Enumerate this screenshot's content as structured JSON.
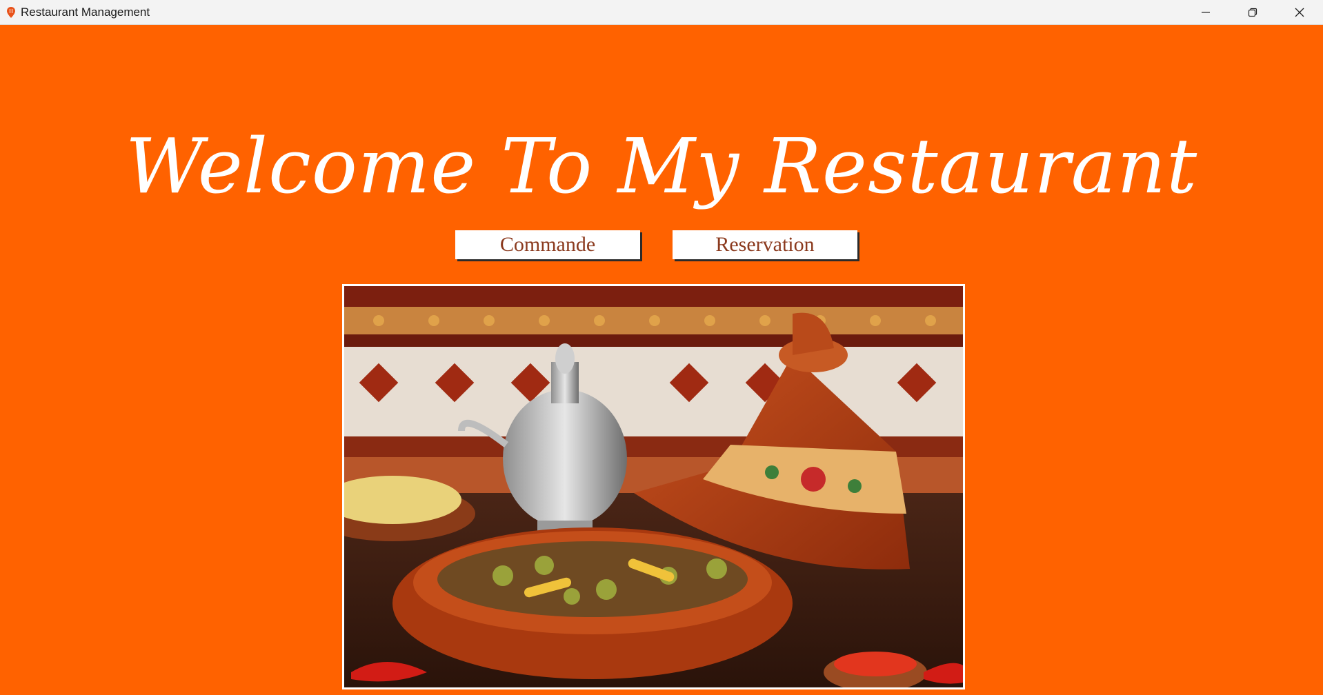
{
  "window": {
    "title": "Restaurant Management",
    "app_icon": "restaurant-pin-icon",
    "controls": [
      "minimize-icon",
      "restore-icon",
      "close-icon"
    ]
  },
  "main": {
    "heading": "Welcome To My Restaurant",
    "buttons": {
      "commande": "Commande",
      "reservation": "Reservation"
    },
    "image": {
      "alt": "Moroccan tagine dish with teapot and couscous",
      "icon": "food-photo"
    }
  },
  "colors": {
    "background": "#ff6200",
    "heading": "#ffffff",
    "button_text": "#8b3a1e",
    "button_bg": "#ffffff"
  }
}
